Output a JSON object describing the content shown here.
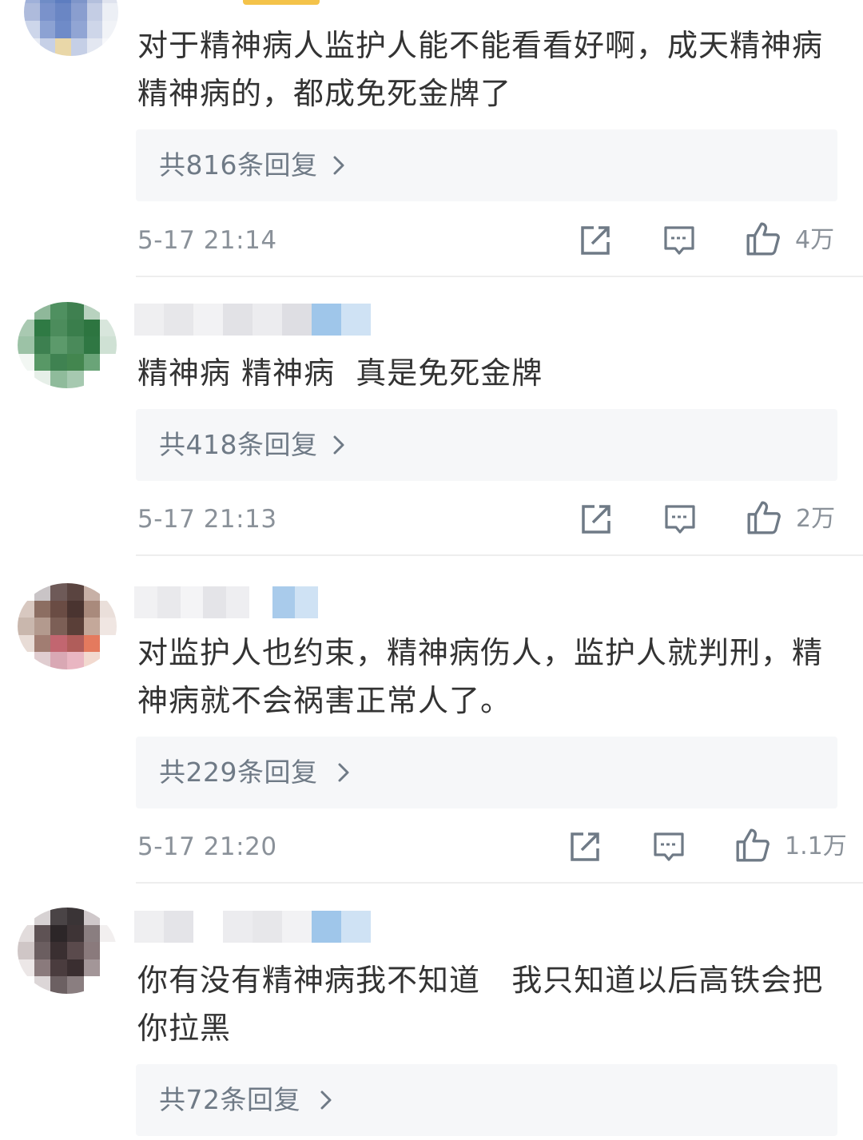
{
  "comments": [
    {
      "text": "对于精神病人监护人能不能看看好啊，成天精神病精神病的，都成免死金牌了",
      "replies_label": "共816条回复",
      "time": "5-17 21:14",
      "likes": "4万"
    },
    {
      "text": "精神病 精神病  真是免死金牌",
      "replies_label": "共418条回复",
      "time": "5-17 21:13",
      "likes": "2万"
    },
    {
      "text": "对监护人也约束，精神病伤人，监护人就判刑，精神病就不会祸害正常人了。",
      "replies_label": "共229条回复",
      "time": "5-17 21:20",
      "likes": "1.1万"
    },
    {
      "text": "你有没有精神病我不知道   我只知道以后高铁会把你拉黑",
      "replies_label": "共72条回复"
    }
  ],
  "icons": {
    "share": "share-icon",
    "comment": "comment-icon",
    "like": "thumbs-up-icon",
    "chevron": "chevron-right-icon"
  },
  "colors": {
    "text": "#333333",
    "meta": "#8a9199",
    "reply_bg": "#f6f7f9",
    "reply_text": "#6f7a86"
  }
}
